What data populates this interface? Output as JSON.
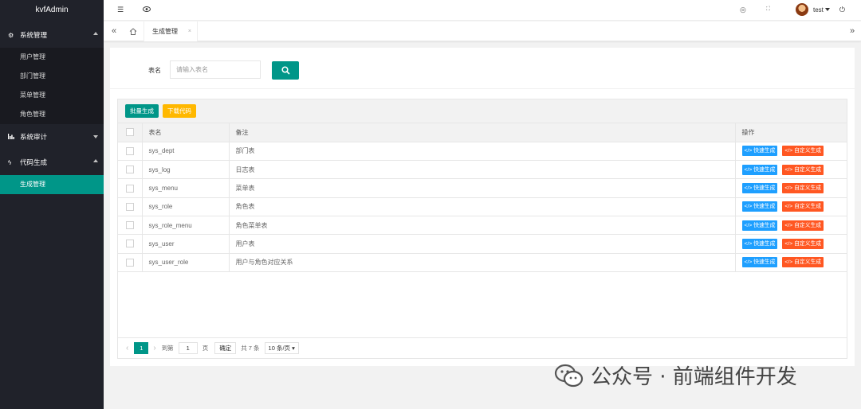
{
  "app": {
    "title": "kvfAdmin"
  },
  "sidebar": {
    "groups": [
      {
        "label": "系统管理",
        "items": [
          "用户管理",
          "部门管理",
          "菜单管理",
          "角色管理"
        ]
      },
      {
        "label": "系统审计"
      },
      {
        "label": "代码生成",
        "items": [
          "生成管理"
        ]
      }
    ]
  },
  "header": {
    "username": "test"
  },
  "tabs": [
    {
      "label": "生成管理",
      "close": "×"
    }
  ],
  "search": {
    "label": "表名",
    "placeholder": "请输入表名"
  },
  "toolbar": {
    "batch_label": "批量生成",
    "download_label": "下载代码"
  },
  "table": {
    "columns": [
      "表名",
      "备注",
      "操作"
    ],
    "rows": [
      {
        "name": "sys_dept",
        "remark": "部门表"
      },
      {
        "name": "sys_log",
        "remark": "日志表"
      },
      {
        "name": "sys_menu",
        "remark": "菜单表"
      },
      {
        "name": "sys_role",
        "remark": "角色表"
      },
      {
        "name": "sys_role_menu",
        "remark": "角色菜单表"
      },
      {
        "name": "sys_user",
        "remark": "用户表"
      },
      {
        "name": "sys_user_role",
        "remark": "用户与角色对应关系"
      }
    ],
    "actions": {
      "quick": "快速生成",
      "custom": "自定义生成"
    }
  },
  "pagination": {
    "current": "1",
    "goto_label": "到第",
    "goto_value": "1",
    "page_suffix": "页",
    "confirm": "确定",
    "total": "共 7 条",
    "page_size": "10 条/页"
  },
  "watermark": {
    "text": "公众号 · 前端组件开发"
  },
  "colors": {
    "sidebar_bg": "#20222a",
    "accent": "#009688",
    "warn": "#ffb800",
    "blue": "#1e9fff",
    "red": "#ff5722"
  }
}
